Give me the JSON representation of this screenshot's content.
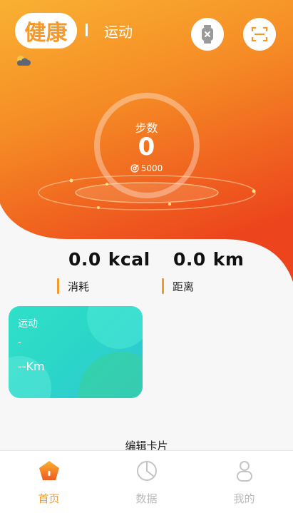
{
  "header": {
    "tab_health": "健康",
    "tab_sport": "运动"
  },
  "steps": {
    "label": "步数",
    "value": "0",
    "goal": "5000"
  },
  "stats": [
    {
      "value": "0.0",
      "unit": "kcal",
      "label": "消耗"
    },
    {
      "value": "0.0",
      "unit": "km",
      "label": "距离"
    }
  ],
  "sport_card": {
    "title": "运动",
    "subtitle": "-",
    "distance": "--Km"
  },
  "edit_cards": "编辑卡片",
  "nav": [
    {
      "label": "首页",
      "icon": "home-pentagon-icon",
      "active": true
    },
    {
      "label": "数据",
      "icon": "data-pie-icon",
      "active": false
    },
    {
      "label": "我的",
      "icon": "profile-icon",
      "active": false
    }
  ],
  "colors": {
    "accent": "#f49a2c",
    "hero_top": "#f8b233",
    "hero_bottom": "#ee4a1e",
    "card_teal": "#2bd6c8",
    "nav_inactive": "#bbbbbb"
  }
}
